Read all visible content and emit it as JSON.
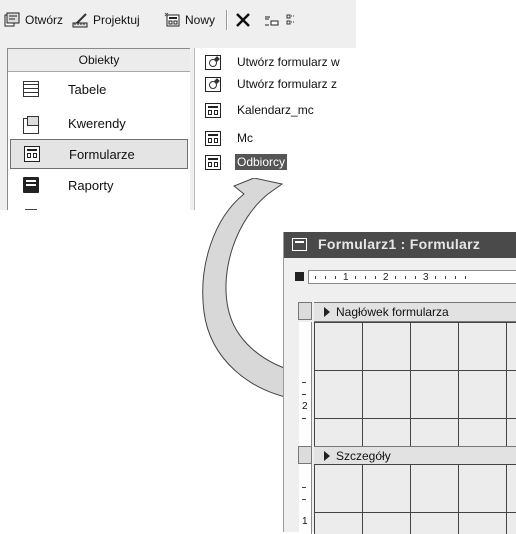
{
  "toolbar": {
    "open_label": "Otwórz",
    "design_label": "Projektuj",
    "new_label": "Nowy"
  },
  "objects_panel": {
    "header": "Obiekty",
    "items": [
      {
        "label": "Tabele",
        "icon": "table-icon"
      },
      {
        "label": "Kwerendy",
        "icon": "query-icon"
      },
      {
        "label": "Formularze",
        "icon": "form-icon",
        "selected": true
      },
      {
        "label": "Raporty",
        "icon": "report-icon"
      }
    ]
  },
  "forms_list": {
    "items": [
      {
        "label": "Utwórz formularz w",
        "icon": "wizard-icon"
      },
      {
        "label": "Utwórz formularz z",
        "icon": "wizard-icon"
      },
      {
        "label": "Kalendarz_mc",
        "icon": "form-icon"
      },
      {
        "label": "Mc",
        "icon": "form-icon"
      },
      {
        "label": "Odbiorcy",
        "icon": "form-icon",
        "selected": true
      }
    ]
  },
  "form_window": {
    "title": "Formularz1 : Formularz",
    "ruler_numbers": [
      "1",
      "2",
      "3"
    ],
    "vruler_numbers": [
      "2",
      "1"
    ],
    "header_section": "Nagłówek formularza",
    "detail_section": "Szczegóły"
  },
  "colors": {
    "titlebar": "#4a4a4a",
    "selection": "#555555",
    "grid_lines": "#444444"
  }
}
